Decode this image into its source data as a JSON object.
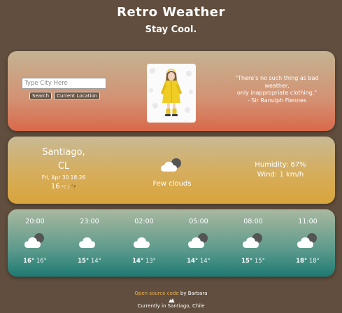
{
  "header": {
    "title": "Retro Weather",
    "subtitle": "Stay Cool."
  },
  "search": {
    "placeholder": "Type City Here",
    "search_label": "Search",
    "location_label": "Current Location"
  },
  "quote": {
    "line1": "\"There's no such thing as bad",
    "line2": "weather,",
    "line3": "only inappropriate clothing.\"",
    "line4": "- Sir Ranulph Fiennes"
  },
  "current": {
    "city": "Santiago,",
    "country": "CL",
    "datetime": "Fri, Apr 30 18:26",
    "temp": "16",
    "unit_c": "°C",
    "separator": "|",
    "unit_f": "°F",
    "condition": "Few clouds",
    "condition_icon": "partly-cloudy-night-icon",
    "humidity": "Humidity: 67%",
    "wind": "Wind: 1 km/h"
  },
  "forecast": [
    {
      "time": "20:00",
      "icon": "partly-cloudy-night-icon",
      "high": "16°",
      "low": "16°"
    },
    {
      "time": "23:00",
      "icon": "cloud-icon",
      "high": "15°",
      "low": "14°"
    },
    {
      "time": "02:00",
      "icon": "cloud-icon",
      "high": "14°",
      "low": "13°"
    },
    {
      "time": "05:00",
      "icon": "partly-cloudy-night-icon",
      "high": "14°",
      "low": "14°"
    },
    {
      "time": "08:00",
      "icon": "partly-cloudy-night-icon",
      "high": "15°",
      "low": "15°"
    },
    {
      "time": "11:00",
      "icon": "partly-cloudy-night-icon",
      "high": "18°",
      "low": "18°"
    }
  ],
  "footer": {
    "link_text": "Open source code",
    "by_text": " by Barbara",
    "location_text": "Currently in Santiago, Chile"
  },
  "colors": {
    "background": "#614e3e",
    "link": "#f0b04b",
    "top_card_bottom": "#d8694a",
    "mid_card_bottom": "#d9a53c",
    "bottom_card_bottom": "#1d7a73"
  }
}
